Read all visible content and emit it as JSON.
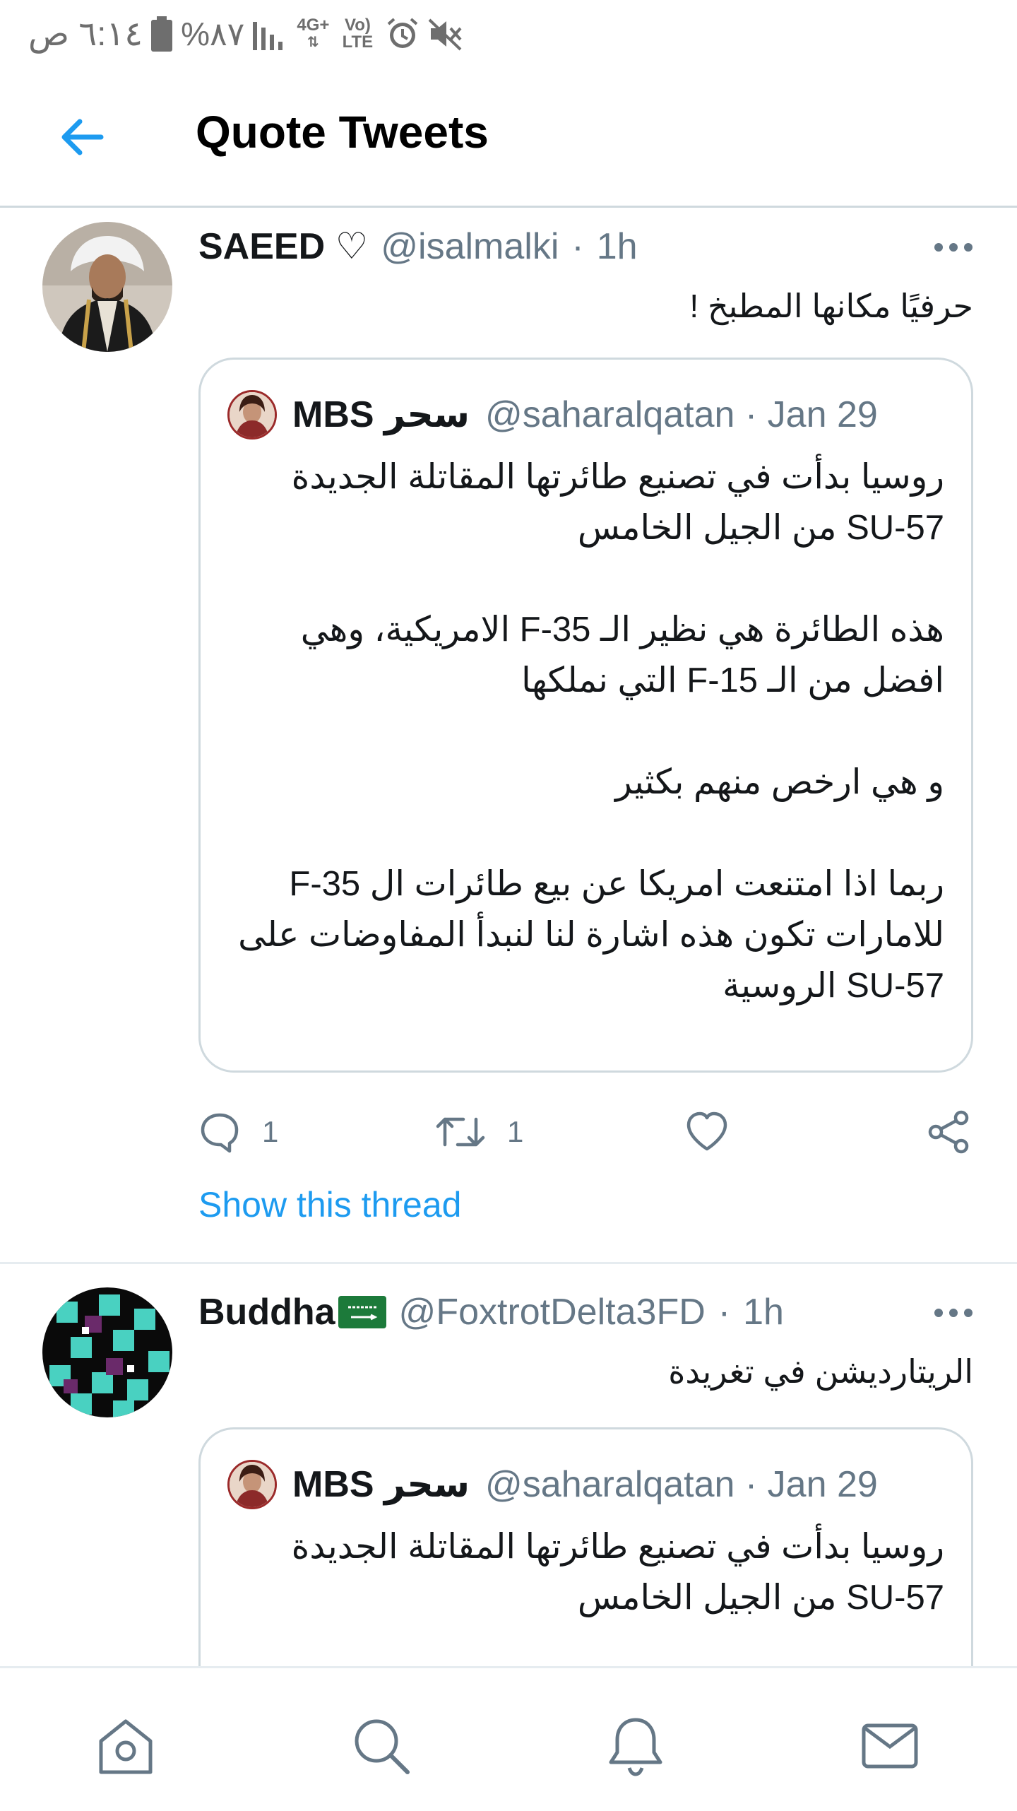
{
  "status_bar": {
    "time": "٦:١٤ ص",
    "battery_percent": "%٨٧",
    "network": "4G+",
    "volte": "Vo) LTE",
    "icons": [
      "battery-icon",
      "signal-icon",
      "network-4g-icon",
      "volte-icon",
      "alarm-icon",
      "mute-icon"
    ]
  },
  "header": {
    "title": "Quote Tweets",
    "back_icon": "arrow-left-icon"
  },
  "tweets": [
    {
      "name": "SAEED ♡",
      "handle": "@isalmalki",
      "dot": "·",
      "time": "1h",
      "text": "حرفيًا مكانها المطبخ !",
      "quote": {
        "name": "سحر MBS",
        "handle": "@saharalqatan · Jan 29",
        "paragraphs": [
          "روسيا بدأت في تصنيع طائرتها المقاتلة الجديدة SU-57 من الجيل الخامس",
          "هذه الطائرة هي نظير الـ F-35 الامريكية، وهي افضل من الـ F-15 التي نملكها",
          "و هي ارخص منهم بكثير",
          "ربما اذا امتنعت امريكا عن بيع طائرات ال F-35 للامارات تكون هذه اشارة لنا لنبدأ المفاوضات على SU-57 الروسية"
        ]
      },
      "reply_count": "1",
      "retweet_count": "1",
      "show_thread": "Show this thread"
    },
    {
      "name": "Buddha",
      "handle": "@FoxtrotDelta3FD",
      "dot": "·",
      "time": "1h",
      "text": "الريتارديشن في تغريدة",
      "quote": {
        "name": "سحر MBS",
        "handle": "@saharalqatan · Jan 29",
        "paragraphs": [
          "روسيا بدأت في تصنيع طائرتها المقاتلة الجديدة SU-57 من الجيل الخامس"
        ]
      }
    }
  ],
  "bottom_nav": [
    "home-icon",
    "search-icon",
    "notifications-icon",
    "messages-icon"
  ],
  "colors": {
    "accent": "#1d9bf0",
    "secondary_text": "#657786",
    "border": "#cfd9de"
  }
}
